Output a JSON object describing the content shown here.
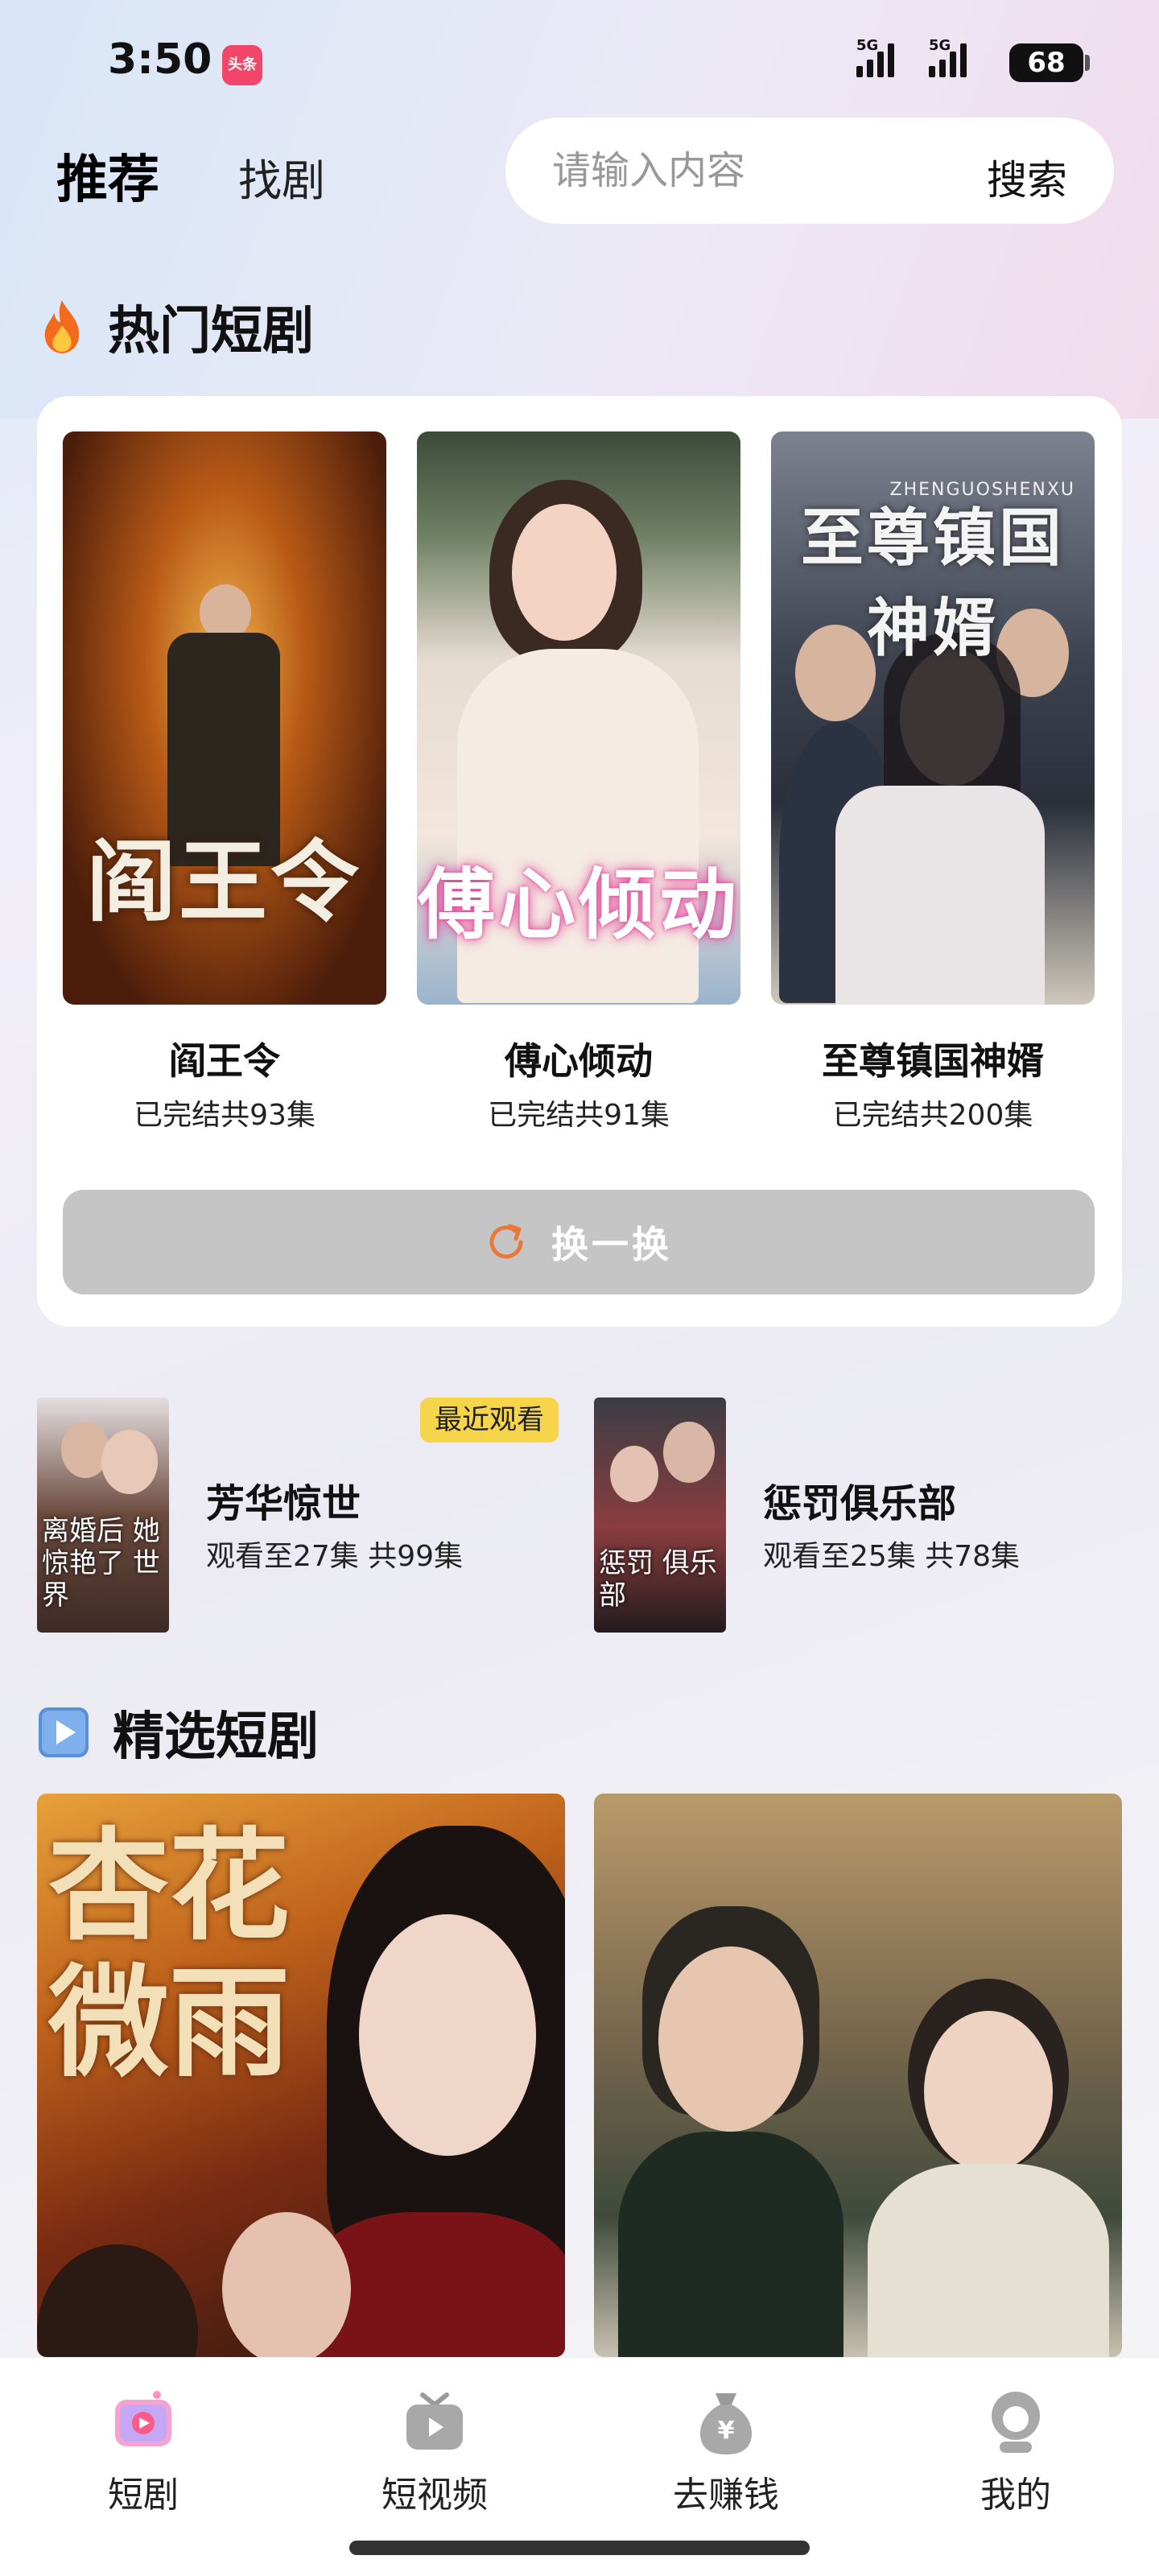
{
  "status_bar": {
    "time": "3:50",
    "app_badge": "头条",
    "network_1": "5G",
    "network_2": "5G",
    "battery": "68"
  },
  "header": {
    "tab_recommend": "推荐",
    "tab_find": "找剧",
    "search_placeholder": "请输入内容",
    "search_button": "搜索"
  },
  "hot_section": {
    "title": "热门短剧",
    "icon": "fire-icon",
    "items": [
      {
        "poster_text": "阎王令",
        "name": "阎王令",
        "info": "已完结共93集"
      },
      {
        "poster_text": "傅心倾动",
        "name": "傅心倾动",
        "info": "已完结共91集"
      },
      {
        "poster_text": "至尊镇国神婿",
        "poster_subtext": "ZHENGUOSHENXU",
        "name": "至尊镇国神婿",
        "info": "已完结共200集"
      }
    ],
    "refresh_label": "换一换",
    "refresh_icon": "refresh-icon",
    "refresh_color": "#e8793a"
  },
  "recent": {
    "badge": "最近观看",
    "items": [
      {
        "title": "芳华惊世",
        "info": "观看至27集 共99集",
        "cover_text": "离婚后 她惊艳了 世界"
      },
      {
        "title": "惩罚俱乐部",
        "info": "观看至25集 共78集",
        "cover_text": "惩罚 俱乐部"
      }
    ]
  },
  "featured_section": {
    "title": "精选短剧",
    "icon": "play-icon",
    "items": [
      {
        "title_art": "杏花微雨"
      },
      {
        "title_art": ""
      }
    ]
  },
  "bottom_nav": {
    "items": [
      {
        "label": "短剧",
        "icon": "short-drama-icon",
        "active": true
      },
      {
        "label": "短视频",
        "icon": "tv-icon"
      },
      {
        "label": "去赚钱",
        "icon": "money-bag-icon"
      },
      {
        "label": "我的",
        "icon": "profile-icon"
      }
    ]
  }
}
